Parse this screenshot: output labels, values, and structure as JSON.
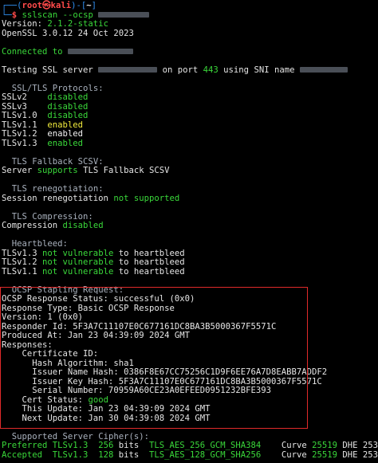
{
  "prompt": {
    "user": "root",
    "at": "㉿",
    "host": "kali",
    "cwd": "~",
    "symbol": "$",
    "command": "sslscan --ocsp"
  },
  "version_line": {
    "label": "Version: ",
    "value": "2.1.2-static"
  },
  "openssl_line": "OpenSSL 3.0.12 24 Oct 2023",
  "connected_prefix": "Connected to",
  "testing": {
    "prefix": "Testing SSL server",
    "mid": "on port",
    "port": "443",
    "suffix": "using SNI name"
  },
  "protocols": {
    "header": "SSL/TLS Protocols:",
    "items": [
      {
        "name": "SSLv2",
        "status": "disabled",
        "color": "grn"
      },
      {
        "name": "SSLv3",
        "status": "disabled",
        "color": "grn"
      },
      {
        "name": "TLSv1.0",
        "status": "disabled",
        "color": "grn"
      },
      {
        "name": "TLSv1.1",
        "status": "enabled",
        "color": "yel"
      },
      {
        "name": "TLSv1.2",
        "status": "enabled",
        "color": "wht"
      },
      {
        "name": "TLSv1.3",
        "status": "enabled",
        "color": "grn"
      }
    ]
  },
  "fallback": {
    "header": "TLS Fallback SCSV:",
    "prefix": "Server ",
    "status": "supports",
    "suffix": " TLS Fallback SCSV"
  },
  "renegotiation": {
    "header": "TLS renegotiation:",
    "prefix": "Session renegotiation ",
    "status": "not supported"
  },
  "compression": {
    "header": "TLS Compression:",
    "prefix": "Compression ",
    "status": "disabled"
  },
  "heartbleed": {
    "header": "Heartbleed:",
    "items": [
      {
        "name": "TLSv1.3 ",
        "status": "not vulnerable",
        "suffix": " to heartbleed"
      },
      {
        "name": "TLSv1.2 ",
        "status": "not vulnerable",
        "suffix": " to heartbleed"
      },
      {
        "name": "TLSv1.1 ",
        "status": "not vulnerable",
        "suffix": " to heartbleed"
      }
    ]
  },
  "ocsp": {
    "header": "OCSP Stapling Request:",
    "lines": [
      "OCSP Response Status: successful (0x0)",
      "Response Type: Basic OCSP Response",
      "Version: 1 (0x0)",
      "Responder Id: 5F3A7C11107E0C677161DC8BA3B5000367F5571C",
      "Produced At: Jan 23 04:39:09 2024 GMT",
      "Responses:",
      "    Certificate ID:",
      "      Hash Algorithm: sha1",
      "      Issuer Name Hash: 0386F8E67CC75256C1D9F6EE76A7D8EABB7ADDF2",
      "      Issuer Key Hash: 5F3A7C11107E0C677161DC8BA3B5000367F5571C",
      "      Serial Number: 70959A60CE23A0EFEED0951232BFE393"
    ],
    "cert_status_label": "    Cert Status: ",
    "cert_status_value": "good",
    "this_update": "    This Update: Jan 23 04:39:09 2024 GMT",
    "next_update": "    Next Update: Jan 30 04:39:08 2024 GMT"
  },
  "ciphers": {
    "header": "Supported Server Cipher(s):",
    "rows": [
      {
        "kind": "Preferred",
        "proto": "TLSv1.3",
        "bits": "256",
        "unit": "bits",
        "name": "TLS_AES_256_GCM_SHA384",
        "curve_label": "Curve",
        "curve": "25519",
        "dhe": "DHE 253"
      },
      {
        "kind": "Accepted",
        "proto": "TLSv1.3",
        "bits": "128",
        "unit": "bits",
        "name": "TLS_AES_128_GCM_SHA256",
        "curve_label": "Curve",
        "curve": "25519",
        "dhe": "DHE 253"
      }
    ]
  },
  "colors": {
    "background": "#000000",
    "green": "#3ad83a",
    "yellow": "#f0ea3c",
    "blue": "#4aa3ff",
    "red": "#ff4a4a",
    "header_gray": "#a9b1bd",
    "highlight_box": "#e02a2a"
  }
}
